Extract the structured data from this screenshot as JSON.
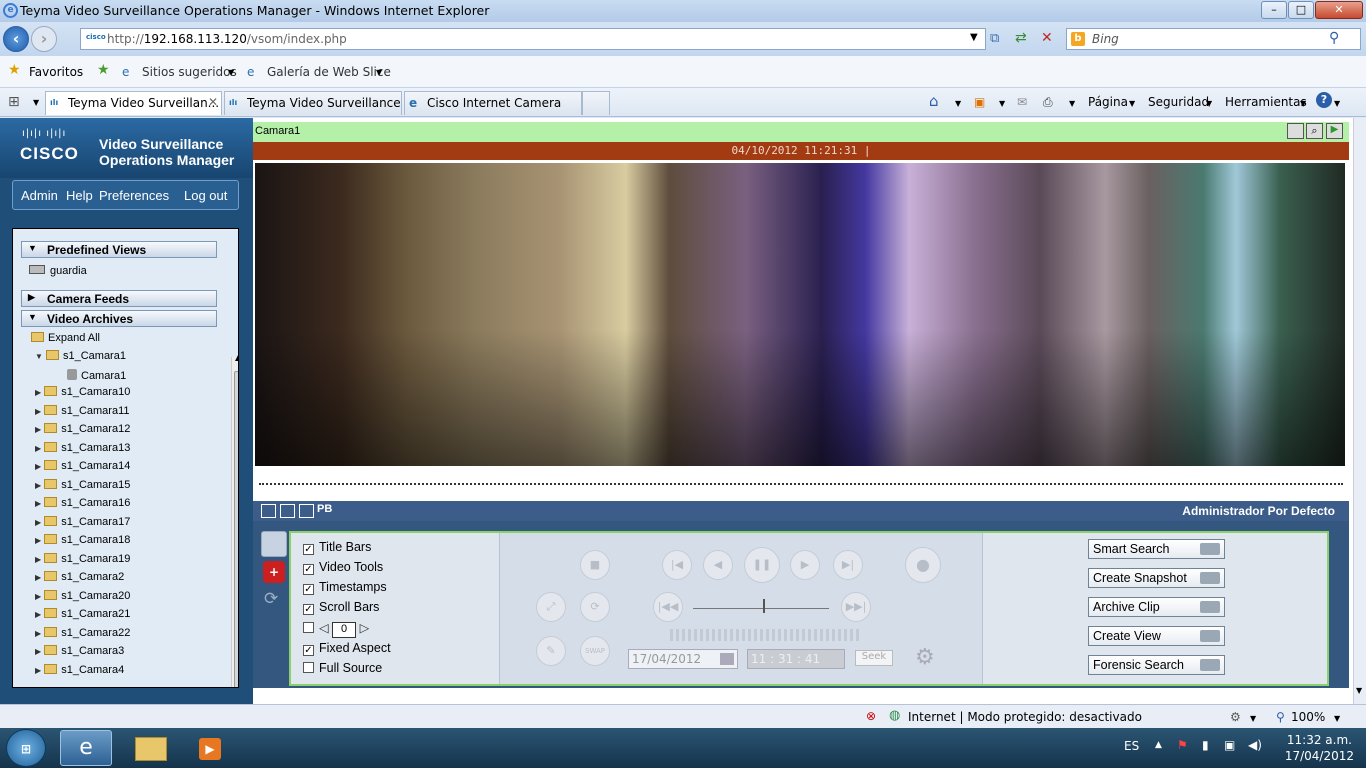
{
  "window": {
    "title": "Teyma Video Surveillance Operations Manager - Windows Internet Explorer"
  },
  "address": {
    "url_prefix": "http://",
    "url_host": "192.168.113.120",
    "url_path": "/vsom/index.php",
    "search_engine": "Bing"
  },
  "favorites": {
    "label": "Favoritos",
    "suggested": "Sitios sugeridos",
    "webslice": "Galería de Web Slice"
  },
  "tabs": [
    {
      "label": "Teyma Video Surveillan...",
      "active": true
    },
    {
      "label": "Teyma Video Surveillance ...",
      "active": false
    },
    {
      "label": "Cisco Internet Camera",
      "active": false
    }
  ],
  "commands": {
    "page": "Página",
    "security": "Seguridad",
    "tools": "Herramientas"
  },
  "brand": {
    "company": "CISCO",
    "product_line1": "Video Surveillance",
    "product_line2": "Operations Manager"
  },
  "menu": {
    "admin": "Admin",
    "help": "Help",
    "preferences": "Preferences",
    "logout": "Log out"
  },
  "tree": {
    "predefined_views": "Predefined Views",
    "view_item": "guardia",
    "camera_feeds": "Camera Feeds",
    "video_archives": "Video Archives",
    "expand_all": "Expand All",
    "open_folder": "s1_Camara1",
    "open_child": "Camara1",
    "folders": [
      "s1_Camara10",
      "s1_Camara11",
      "s1_Camara12",
      "s1_Camara13",
      "s1_Camara14",
      "s1_Camara15",
      "s1_Camara16",
      "s1_Camara17",
      "s1_Camara18",
      "s1_Camara19",
      "s1_Camara2",
      "s1_Camara20",
      "s1_Camara21",
      "s1_Camara22",
      "s1_Camara3",
      "s1_Camara4"
    ]
  },
  "camera": {
    "title": "Camara1",
    "timestamp": "04/10/2012 11:21:31 |"
  },
  "controls": {
    "pb_label": "PB",
    "user": "Administrador Por Defecto",
    "options": [
      {
        "label": "Title Bars",
        "checked": true
      },
      {
        "label": "Video Tools",
        "checked": true
      },
      {
        "label": "Timestamps",
        "checked": true
      },
      {
        "label": "Scroll Bars",
        "checked": true
      }
    ],
    "spin_value": "0",
    "options2": [
      {
        "label": "Fixed Aspect",
        "checked": true
      },
      {
        "label": "Full Source",
        "checked": false
      }
    ],
    "swap_label": "SWAP",
    "date_value": "17/04/2012",
    "time_value": "11 : 31 : 41",
    "seek_label": "Seek",
    "actions": [
      "Smart Search",
      "Create Snapshot",
      "Archive Clip",
      "Create View",
      "Forensic Search"
    ]
  },
  "status": {
    "text": "Internet | Modo protegido: desactivado",
    "zoom": "100%"
  },
  "taskbar": {
    "lang": "ES",
    "time": "11:32 a.m.",
    "date": "17/04/2012"
  },
  "colors": {
    "title_green": "#b4f0a8",
    "timestamp_bar": "#a23a12",
    "sidebar": "#1f4e79",
    "panel_border": "#8bd16a"
  }
}
